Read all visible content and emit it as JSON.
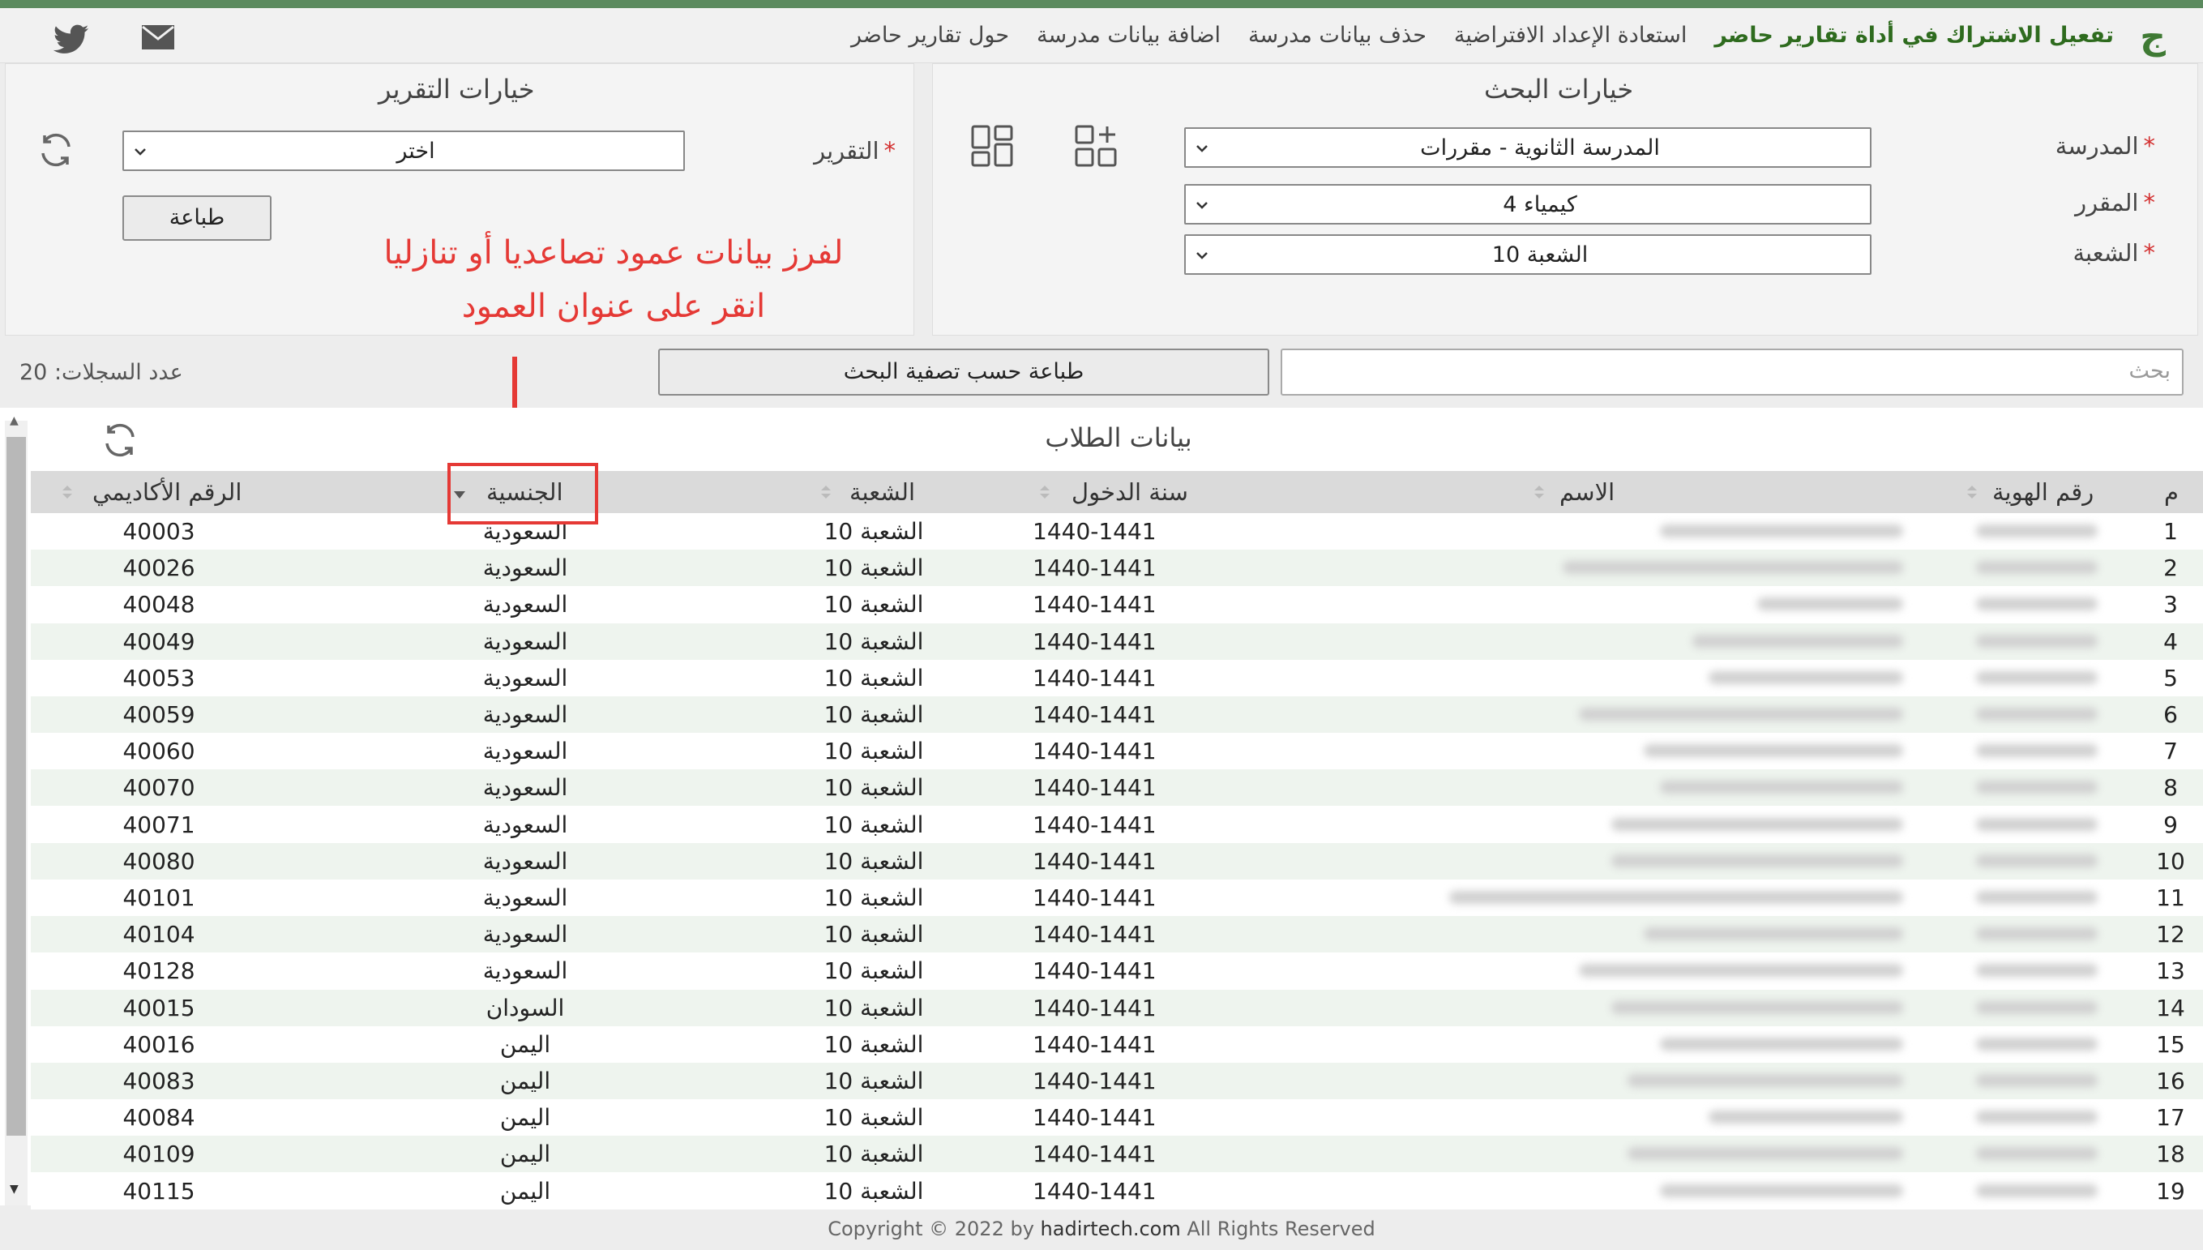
{
  "nav": {
    "logo": "ج",
    "links": [
      "حول تقارير حاضر",
      "اضافة بيانات مدرسة",
      "حذف بيانات مدرسة",
      "استعادة الإعداد الافتراضية",
      "تفعيل الاشتراك في أداة تقارير حاضر"
    ],
    "icons": [
      "twitter-icon",
      "mail-icon"
    ]
  },
  "search_panel": {
    "title": "خيارات البحث",
    "school_label": "المدرسة",
    "school_value": "المدرسة الثانوية - مقررات",
    "course_label": "المقرر",
    "course_value": "كيمياء 4",
    "section_label": "الشعبة",
    "section_value": "الشعبة 10",
    "required_mark": "*"
  },
  "report_panel": {
    "title": "خيارات التقرير",
    "report_label": "التقرير",
    "report_value": "اختر",
    "print_button": "طباعة",
    "required_mark": "*"
  },
  "annotation": {
    "line1": "لفرز بيانات عمود تصاعديا أو تنازليا",
    "line2": "انقر على عنوان العمود"
  },
  "toolbar": {
    "search_placeholder": "بحث",
    "print_filtered_button": "طباعة حسب تصفية البحث",
    "records_count": "عدد السجلات: 20"
  },
  "table": {
    "title": "بيانات الطلاب",
    "columns": [
      "م",
      "رقم الهوية",
      "الاسم",
      "سنة الدخول",
      "الشعبة",
      "الجنسية",
      "الرقم الأكاديمي"
    ],
    "sorted_column": "الجنسية",
    "rows": [
      {
        "n": "1",
        "year": "1440-1441",
        "section": "الشعبة 10",
        "nationality": "السعودية",
        "academic": "40003"
      },
      {
        "n": "2",
        "year": "1440-1441",
        "section": "الشعبة 10",
        "nationality": "السعودية",
        "academic": "40026"
      },
      {
        "n": "3",
        "year": "1440-1441",
        "section": "الشعبة 10",
        "nationality": "السعودية",
        "academic": "40048"
      },
      {
        "n": "4",
        "year": "1440-1441",
        "section": "الشعبة 10",
        "nationality": "السعودية",
        "academic": "40049"
      },
      {
        "n": "5",
        "year": "1440-1441",
        "section": "الشعبة 10",
        "nationality": "السعودية",
        "academic": "40053"
      },
      {
        "n": "6",
        "year": "1440-1441",
        "section": "الشعبة 10",
        "nationality": "السعودية",
        "academic": "40059"
      },
      {
        "n": "7",
        "year": "1440-1441",
        "section": "الشعبة 10",
        "nationality": "السعودية",
        "academic": "40060"
      },
      {
        "n": "8",
        "year": "1440-1441",
        "section": "الشعبة 10",
        "nationality": "السعودية",
        "academic": "40070"
      },
      {
        "n": "9",
        "year": "1440-1441",
        "section": "الشعبة 10",
        "nationality": "السعودية",
        "academic": "40071"
      },
      {
        "n": "10",
        "year": "1440-1441",
        "section": "الشعبة 10",
        "nationality": "السعودية",
        "academic": "40080"
      },
      {
        "n": "11",
        "year": "1440-1441",
        "section": "الشعبة 10",
        "nationality": "السعودية",
        "academic": "40101"
      },
      {
        "n": "12",
        "year": "1440-1441",
        "section": "الشعبة 10",
        "nationality": "السعودية",
        "academic": "40104"
      },
      {
        "n": "13",
        "year": "1440-1441",
        "section": "الشعبة 10",
        "nationality": "السعودية",
        "academic": "40128"
      },
      {
        "n": "14",
        "year": "1440-1441",
        "section": "الشعبة 10",
        "nationality": "السودان",
        "academic": "40015"
      },
      {
        "n": "15",
        "year": "1440-1441",
        "section": "الشعبة 10",
        "nationality": "اليمن",
        "academic": "40016"
      },
      {
        "n": "16",
        "year": "1440-1441",
        "section": "الشعبة 10",
        "nationality": "اليمن",
        "academic": "40083"
      },
      {
        "n": "17",
        "year": "1440-1441",
        "section": "الشعبة 10",
        "nationality": "اليمن",
        "academic": "40084"
      },
      {
        "n": "18",
        "year": "1440-1441",
        "section": "الشعبة 10",
        "nationality": "اليمن",
        "academic": "40109"
      },
      {
        "n": "19",
        "year": "1440-1441",
        "section": "الشعبة 10",
        "nationality": "اليمن",
        "academic": "40115"
      }
    ]
  },
  "footer": {
    "prefix": "Copyright © 2022 by",
    "brand": "hadirtech.com",
    "suffix": "All Rights Reserved"
  },
  "colors": {
    "accent_green": "#3f7a34",
    "annotation_red": "#e53935",
    "row_alt": "#eef4ee"
  }
}
